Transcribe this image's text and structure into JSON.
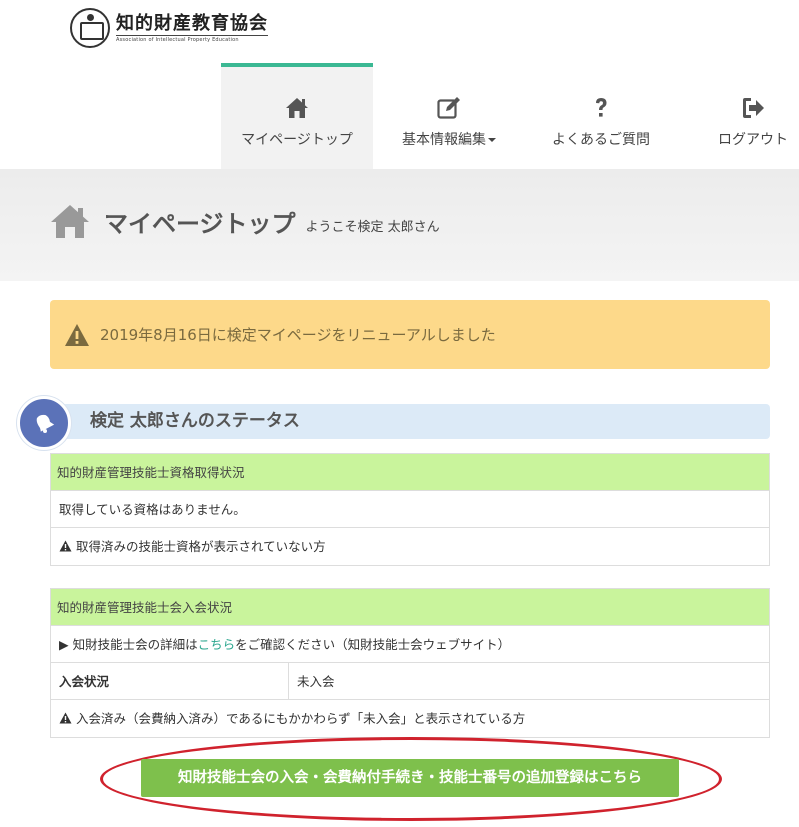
{
  "brand": {
    "name_jp": "知的財産教育協会",
    "name_en": "Association of Intellectual Property Education"
  },
  "nav": {
    "items": [
      {
        "label": "マイページトップ",
        "icon": "home-icon",
        "active": true
      },
      {
        "label": "基本情報編集",
        "icon": "edit-icon",
        "dropdown": true
      },
      {
        "label": "よくあるご質問",
        "icon": "question-icon"
      },
      {
        "label": "ログアウト",
        "icon": "logout-icon"
      }
    ],
    "accent": "#3bb893"
  },
  "page": {
    "title": "マイページトップ",
    "welcome": "ようこそ検定 太郎さん"
  },
  "notice": {
    "icon": "warning-icon",
    "text": "2019年8月16日に検定マイページをリニューアルしました",
    "color": "#fdd98a"
  },
  "status": {
    "title": "検定 太郎さんのステータス",
    "icon": "bell-icon"
  },
  "qualification": {
    "header": "知的財産管理技能士資格取得状況",
    "none_text": "取得している資格はありません。",
    "help_text": "取得済みの技能士資格が表示されていない方"
  },
  "membership": {
    "header": "知的財産管理技能士会入会状況",
    "info_prefix": "▶ 知財技能士会の詳細は",
    "info_link": "こちら",
    "info_suffix": "をご確認ください（知財技能士会ウェブサイト）",
    "status_label": "入会状況",
    "status_value": "未入会",
    "help_text": "入会済み（会費納入済み）であるにもかかわらず「未入会」と表示されている方"
  },
  "cta": {
    "label": "知財技能士会の入会・会費納付手続き・技能士番号の追加登録はこちら",
    "color": "#7ec04c",
    "highlight_color": "#d0222d"
  }
}
